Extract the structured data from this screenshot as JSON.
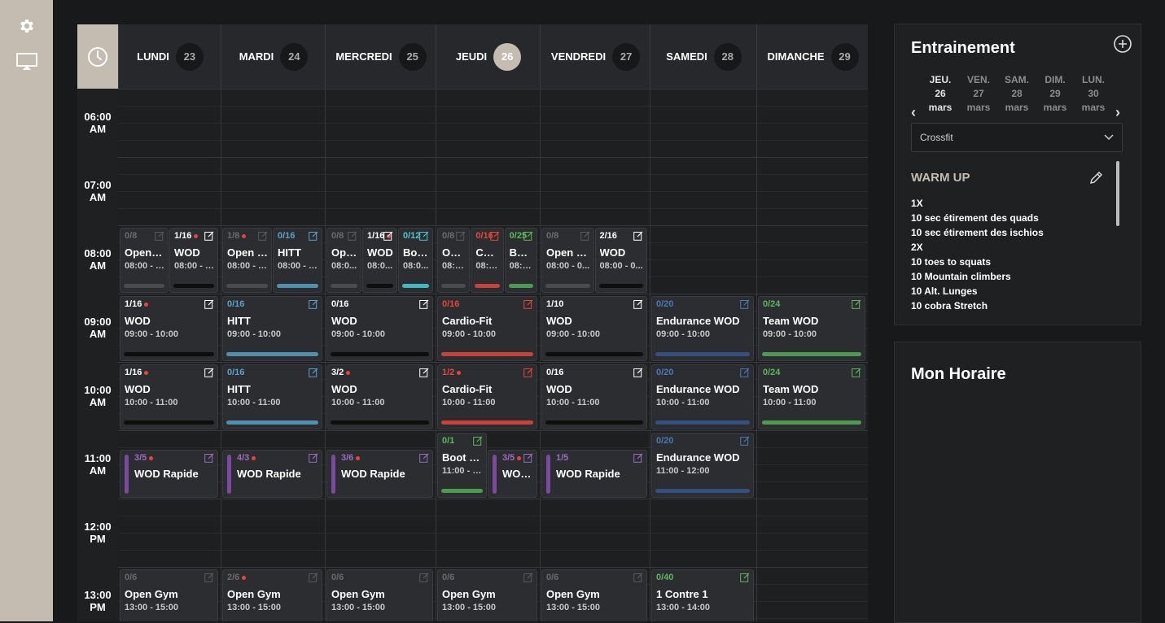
{
  "calendar": {
    "days": [
      {
        "name": "LUNDI",
        "num": "23"
      },
      {
        "name": "MARDI",
        "num": "24"
      },
      {
        "name": "MERCREDI",
        "num": "25"
      },
      {
        "name": "JEUDI",
        "num": "26",
        "today": true
      },
      {
        "name": "VENDREDI",
        "num": "27"
      },
      {
        "name": "SAMEDI",
        "num": "28"
      },
      {
        "name": "DIMANCHE",
        "num": "29"
      }
    ],
    "times": [
      {
        "h": "06:00",
        "ap": "AM"
      },
      {
        "h": "07:00",
        "ap": "AM"
      },
      {
        "h": "08:00",
        "ap": "AM"
      },
      {
        "h": "09:00",
        "ap": "AM"
      },
      {
        "h": "10:00",
        "ap": "AM"
      },
      {
        "h": "11:00",
        "ap": "AM"
      },
      {
        "h": "12:00",
        "ap": "PM"
      },
      {
        "h": "13:00",
        "ap": "PM"
      }
    ],
    "events": [
      {
        "day": 0,
        "col": 0,
        "cols": 2,
        "hour": 8,
        "count": "0/8",
        "title": "Open G...",
        "time": "08:00 - 0...",
        "color": "#4a4b4e",
        "countColor": "#6b6b6b",
        "dim": true
      },
      {
        "day": 0,
        "col": 1,
        "cols": 2,
        "hour": 8,
        "count": "1/16",
        "dot": true,
        "title": "WOD",
        "time": "08:00 - 0...",
        "color": "#0e0e0e",
        "countColor": "#ffffff"
      },
      {
        "day": 1,
        "col": 0,
        "cols": 2,
        "hour": 8,
        "count": "1/8",
        "dot": true,
        "title": "Open G...",
        "time": "08:00 - 0...",
        "color": "#4a4b4e",
        "countColor": "#6b6b6b",
        "dim": true
      },
      {
        "day": 1,
        "col": 1,
        "cols": 2,
        "hour": 8,
        "count": "0/16",
        "title": "HITT",
        "time": "08:00 - 0...",
        "color": "#4f8fb0",
        "countColor": "#5aa2c8"
      },
      {
        "day": 2,
        "col": 0,
        "cols": 3,
        "hour": 8,
        "count": "0/8",
        "title": "Ope...",
        "time": "08:0...",
        "color": "#4a4b4e",
        "countColor": "#6b6b6b",
        "dim": true
      },
      {
        "day": 2,
        "col": 1,
        "cols": 3,
        "hour": 8,
        "count": "1/16",
        "dot": true,
        "title": "WOD",
        "time": "08:0...",
        "color": "#0e0e0e",
        "countColor": "#ffffff"
      },
      {
        "day": 2,
        "col": 2,
        "cols": 3,
        "hour": 8,
        "count": "0/12",
        "title": "Boo...",
        "time": "08:0...",
        "color": "#3fb8c6",
        "countColor": "#4fc3d1"
      },
      {
        "day": 3,
        "col": 0,
        "cols": 3,
        "hour": 8,
        "count": "0/8",
        "title": "Ope...",
        "time": "08:0...",
        "color": "#4a4b4e",
        "countColor": "#6b6b6b",
        "dim": true
      },
      {
        "day": 3,
        "col": 1,
        "cols": 3,
        "hour": 8,
        "count": "0/16",
        "title": "Car...",
        "time": "08:0...",
        "color": "#c8413a",
        "countColor": "#e5463c"
      },
      {
        "day": 3,
        "col": 2,
        "cols": 3,
        "hour": 8,
        "count": "0/25",
        "title": "Boo...",
        "time": "08:0...",
        "color": "#4d9a52",
        "countColor": "#5cb85c"
      },
      {
        "day": 4,
        "col": 0,
        "cols": 2,
        "hour": 8,
        "count": "0/8",
        "title": "Open G...",
        "time": "08:00 - 0...",
        "color": "#4a4b4e",
        "countColor": "#6b6b6b",
        "dim": true
      },
      {
        "day": 4,
        "col": 1,
        "cols": 2,
        "hour": 8,
        "count": "2/16",
        "title": "WOD",
        "time": "08:00 - 0...",
        "color": "#0e0e0e",
        "countColor": "#ffffff"
      },
      {
        "day": 0,
        "hour": 9,
        "count": "1/16",
        "dot": true,
        "title": "WOD",
        "time": "09:00 - 10:00",
        "color": "#0e0e0e",
        "countColor": "#ffffff"
      },
      {
        "day": 1,
        "hour": 9,
        "count": "0/16",
        "title": "HITT",
        "time": "09:00 - 10:00",
        "color": "#4f8fb0",
        "countColor": "#5aa2c8"
      },
      {
        "day": 2,
        "hour": 9,
        "count": "0/16",
        "title": "WOD",
        "time": "09:00 - 10:00",
        "color": "#0e0e0e",
        "countColor": "#ffffff"
      },
      {
        "day": 3,
        "hour": 9,
        "count": "0/16",
        "title": "Cardio-Fit",
        "time": "09:00 - 10:00",
        "color": "#c8413a",
        "countColor": "#e5463c"
      },
      {
        "day": 4,
        "hour": 9,
        "count": "1/10",
        "title": "WOD",
        "time": "09:00 - 10:00",
        "color": "#0e0e0e",
        "countColor": "#ffffff"
      },
      {
        "day": 5,
        "hour": 9,
        "count": "0/20",
        "title": "Endurance WOD",
        "time": "09:00 - 10:00",
        "color": "#34507e",
        "countColor": "#4a78b8"
      },
      {
        "day": 6,
        "hour": 9,
        "count": "0/24",
        "title": "Team WOD",
        "time": "09:00 - 10:00",
        "color": "#4d9a52",
        "countColor": "#5cb85c"
      },
      {
        "day": 0,
        "hour": 10,
        "count": "1/16",
        "dot": true,
        "title": "WOD",
        "time": "10:00 - 11:00",
        "color": "#0e0e0e",
        "countColor": "#ffffff"
      },
      {
        "day": 1,
        "hour": 10,
        "count": "0/16",
        "title": "HITT",
        "time": "10:00 - 11:00",
        "color": "#4f8fb0",
        "countColor": "#5aa2c8"
      },
      {
        "day": 2,
        "hour": 10,
        "count": "3/2",
        "dot": true,
        "title": "WOD",
        "time": "10:00 - 11:00",
        "color": "#0e0e0e",
        "countColor": "#ffffff"
      },
      {
        "day": 3,
        "hour": 10,
        "count": "1/2",
        "dot": true,
        "title": "Cardio-Fit",
        "time": "10:00 - 11:00",
        "color": "#c8413a",
        "countColor": "#e5463c"
      },
      {
        "day": 4,
        "hour": 10,
        "count": "0/16",
        "title": "WOD",
        "time": "10:00 - 11:00",
        "color": "#0e0e0e",
        "countColor": "#ffffff"
      },
      {
        "day": 5,
        "hour": 10,
        "count": "0/20",
        "title": "Endurance WOD",
        "time": "10:00 - 11:00",
        "color": "#34507e",
        "countColor": "#4a78b8"
      },
      {
        "day": 6,
        "hour": 10,
        "count": "0/24",
        "title": "Team WOD",
        "time": "10:00 - 11:00",
        "color": "#4d9a52",
        "countColor": "#5cb85c"
      },
      {
        "day": 0,
        "hour": 11.25,
        "short": true,
        "count": "3/5",
        "dot": true,
        "title": "WOD Rapide",
        "color": "#7b4aa0",
        "countColor": "#9b6bc0"
      },
      {
        "day": 1,
        "hour": 11.25,
        "short": true,
        "count": "4/3",
        "dot": true,
        "title": "WOD Rapide",
        "color": "#7b4aa0",
        "countColor": "#9b6bc0"
      },
      {
        "day": 2,
        "hour": 11.25,
        "short": true,
        "count": "3/6",
        "dot": true,
        "title": "WOD Rapide",
        "color": "#7b4aa0",
        "countColor": "#9b6bc0"
      },
      {
        "day": 3,
        "col": 0,
        "cols": 2,
        "hour": 11,
        "count": "0/1",
        "title": "Boot C...",
        "time": "11:00 - 1...",
        "color": "#4d9a52",
        "countColor": "#5cb85c"
      },
      {
        "day": 3,
        "col": 1,
        "cols": 2,
        "hour": 11.25,
        "short": true,
        "count": "3/5",
        "dot": true,
        "title": "WOD ...",
        "color": "#7b4aa0",
        "countColor": "#9b6bc0"
      },
      {
        "day": 4,
        "hour": 11.25,
        "short": true,
        "count": "1/5",
        "title": "WOD Rapide",
        "color": "#7b4aa0",
        "countColor": "#9b6bc0"
      },
      {
        "day": 5,
        "hour": 11,
        "count": "0/20",
        "title": "Endurance WOD",
        "time": "11:00 - 12:00",
        "color": "#34507e",
        "countColor": "#4a78b8"
      },
      {
        "day": 0,
        "hour": 13,
        "count": "0/6",
        "title": "Open Gym",
        "time": "13:00 - 15:00",
        "color": "#4a4b4e",
        "countColor": "#6b6b6b",
        "dim": true
      },
      {
        "day": 1,
        "hour": 13,
        "count": "2/6",
        "dot": true,
        "title": "Open Gym",
        "time": "13:00 - 15:00",
        "color": "#4a4b4e",
        "countColor": "#6b6b6b",
        "dim": true
      },
      {
        "day": 2,
        "hour": 13,
        "count": "0/6",
        "title": "Open Gym",
        "time": "13:00 - 15:00",
        "color": "#4a4b4e",
        "countColor": "#6b6b6b",
        "dim": true
      },
      {
        "day": 3,
        "hour": 13,
        "count": "0/6",
        "title": "Open Gym",
        "time": "13:00 - 15:00",
        "color": "#4a4b4e",
        "countColor": "#6b6b6b",
        "dim": true
      },
      {
        "day": 4,
        "hour": 13,
        "count": "0/6",
        "title": "Open Gym",
        "time": "13:00 - 15:00",
        "color": "#4a4b4e",
        "countColor": "#6b6b6b",
        "dim": true
      },
      {
        "day": 5,
        "hour": 13,
        "count": "0/40",
        "title": "1 Contre 1",
        "time": "13:00 - 14:00",
        "color": "#4d9a52",
        "countColor": "#5cb85c"
      }
    ]
  },
  "training": {
    "title": "Entrainement",
    "dates": [
      {
        "dow": "JEU.",
        "day": "26",
        "month": "mars",
        "active": true
      },
      {
        "dow": "VEN.",
        "day": "27",
        "month": "mars"
      },
      {
        "dow": "SAM.",
        "day": "28",
        "month": "mars"
      },
      {
        "dow": "DIM.",
        "day": "29",
        "month": "mars"
      },
      {
        "dow": "LUN.",
        "day": "30",
        "month": "mars"
      }
    ],
    "prev": "‹",
    "next": "›",
    "program": "Crossfit",
    "section_title": "WARM UP",
    "lines": [
      "1X",
      "10 sec étirement des quads",
      "10 sec étirement des ischios",
      "2X",
      "10 toes to squats",
      "10 Mountain climbers",
      "10 Alt. Lunges",
      "10 cobra Stretch"
    ]
  },
  "schedule": {
    "title": "Mon Horaire"
  }
}
